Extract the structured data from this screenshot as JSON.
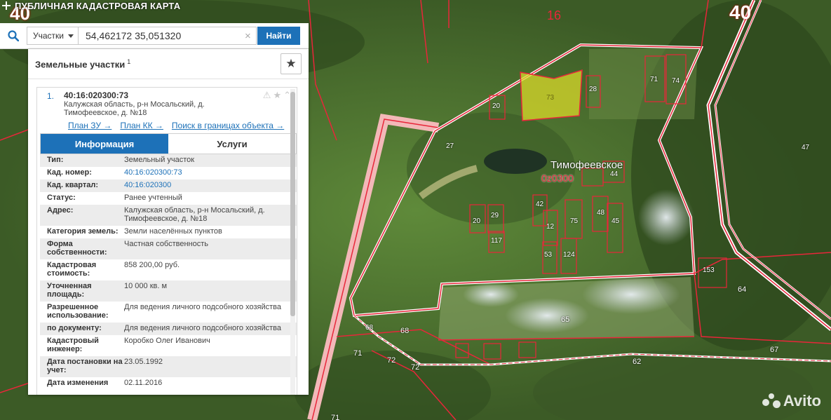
{
  "header": {
    "title": "ПУБЛИЧНАЯ КАДАСТРОВАЯ КАРТА"
  },
  "search": {
    "type_label": "Участки",
    "query": "54,462172 35,051320",
    "clear_glyph": "×",
    "button_label": "Найти"
  },
  "panel": {
    "title": "Земельные участки",
    "count": "1",
    "fav_glyph": "★"
  },
  "result": {
    "number": "1.",
    "cad_id": "40:16:020300:73",
    "address": "Калужская область, р-н Мосальский, д. Тимофеевское, д. №18",
    "icons": [
      "⚠",
      "★",
      "⌃"
    ],
    "links": {
      "plan_zu": "План ЗУ →",
      "plan_kk": "План КК →",
      "search_bounds": "Поиск в границах объекта →"
    },
    "tabs": {
      "info": "Информация",
      "services": "Услуги"
    },
    "info": [
      {
        "label": "Тип:",
        "value": "Земельный участок"
      },
      {
        "label": "Кад. номер:",
        "value": "40:16:020300:73",
        "link": true
      },
      {
        "label": "Кад. квартал:",
        "value": "40:16:020300",
        "link": true
      },
      {
        "label": "Статус:",
        "value": "Ранее учтенный"
      },
      {
        "label": "Адрес:",
        "value": "Калужская область, р-н Мосальский, д. Тимофеевское, д. №18"
      },
      {
        "label": "Категория земель:",
        "value": "Земли населённых пунктов"
      },
      {
        "label": "Форма собственности:",
        "value": "Частная собственность"
      },
      {
        "label": "Кадастровая стоимость:",
        "value": "858 200,00 руб."
      },
      {
        "label": "Уточненная площадь:",
        "value": "10 000 кв. м"
      },
      {
        "label": "Разрешенное использование:",
        "value": "Для ведения личного подсобного хозяйства"
      },
      {
        "label": "по документу:",
        "value": "Для ведения личного подсобного хозяйства"
      },
      {
        "label": "Кадастровый инженер:",
        "value": "Коробко Олег Иванович"
      },
      {
        "label": "Дата постановки на учет:",
        "value": "23.05.1992"
      },
      {
        "label": "Дата изменения",
        "value": "02.11.2016"
      }
    ]
  },
  "map": {
    "labels": {
      "quarter_40_left": "40",
      "quarter_40_right": "40",
      "quarter_16": "16",
      "village_name": "Тимофеевское",
      "village_code": "0z0300",
      "n73": "73",
      "n74": "74",
      "n71": "71",
      "n28": "28",
      "n20a": "20",
      "n27": "27",
      "n47": "47",
      "n44": "44",
      "n42": "42",
      "n29": "29",
      "n20b": "20",
      "n117": "117",
      "n12": "12",
      "n75": "75",
      "n48": "48",
      "n45": "45",
      "n53": "53",
      "n124": "124",
      "n153": "153",
      "n64": "64",
      "n65": "65",
      "n68a": "68",
      "n68b": "68",
      "n71b": "71",
      "n72a": "72",
      "n72b": "72",
      "n62": "62",
      "n67": "67",
      "n71c": "71"
    },
    "colors": {
      "boundary": "#e8263a",
      "selected_fill": "#d9d92a",
      "road": "#f2b9b9"
    }
  },
  "watermark": {
    "text": "Avito"
  }
}
